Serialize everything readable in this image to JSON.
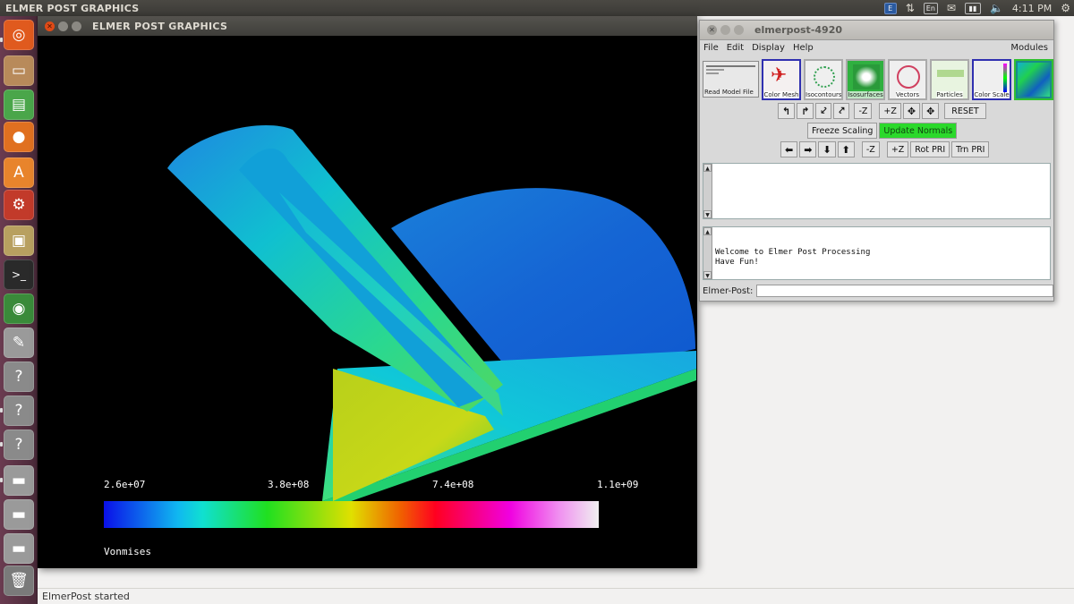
{
  "top_panel": {
    "title": "ELMER POST GRAPHICS",
    "tray": {
      "e_icon": "E",
      "keyboard": "En",
      "clock": "4:11 PM"
    }
  },
  "launcher": {
    "icons": [
      {
        "name": "ubuntu-dash-icon",
        "glyph": "◎",
        "color": "#e05a1e"
      },
      {
        "name": "files-icon",
        "glyph": "▭",
        "color": "#b88a5a"
      },
      {
        "name": "spreadsheet-icon",
        "glyph": "▤",
        "color": "#4aa64a"
      },
      {
        "name": "firefox-icon",
        "glyph": "●",
        "color": "#e07020"
      },
      {
        "name": "software-center-icon",
        "glyph": "A",
        "color": "#e8842c"
      },
      {
        "name": "settings-icon",
        "glyph": "⚙",
        "color": "#c23a2a"
      },
      {
        "name": "archive-icon",
        "glyph": "▣",
        "color": "#b8a060"
      },
      {
        "name": "terminal-icon",
        "glyph": ">_",
        "color": "#2a2a2a"
      },
      {
        "name": "chrome-icon",
        "glyph": "◉",
        "color": "#3a8a3a"
      },
      {
        "name": "text-editor-icon",
        "glyph": "✎",
        "color": "#9a9a9a"
      },
      {
        "name": "unknown-app-icon",
        "glyph": "?",
        "color": "#8a8a8a"
      },
      {
        "name": "unknown-app-icon",
        "glyph": "?",
        "color": "#8a8a8a"
      },
      {
        "name": "unknown-app-icon",
        "glyph": "?",
        "color": "#8a8a8a"
      },
      {
        "name": "drive-icon",
        "glyph": "▬",
        "color": "#9a9a9a"
      },
      {
        "name": "drive-icon",
        "glyph": "▬",
        "color": "#9a9a9a"
      },
      {
        "name": "drive-icon",
        "glyph": "▬",
        "color": "#9a9a9a"
      },
      {
        "name": "trash-icon",
        "glyph": "🗑",
        "color": "#7a7a7a"
      }
    ]
  },
  "graphics_window": {
    "title": "ELMER POST GRAPHICS",
    "legend": {
      "ticks": [
        "2.6e+07",
        "3.8e+08",
        "7.4e+08",
        "1.1e+09"
      ],
      "variable": "Vonmises"
    }
  },
  "status_bar": {
    "text": "ElmerPost started"
  },
  "control_window": {
    "title": "elmerpost-4920",
    "menu": [
      "File",
      "Edit",
      "Display",
      "Help"
    ],
    "menu_right": "Modules",
    "read_model_file": "Read Model File",
    "modules": [
      {
        "label": "Color Mesh",
        "active": true
      },
      {
        "label": "Isocontours",
        "active": false
      },
      {
        "label": "Isosurfaces",
        "active": false
      },
      {
        "label": "Vectors",
        "active": false
      },
      {
        "label": "Particles",
        "active": false
      },
      {
        "label": "Color Scale",
        "active": true
      },
      {
        "label": "",
        "active": false
      }
    ],
    "rotate_row": {
      "minus_z": "-Z",
      "plus_z": "+Z",
      "reset": "RESET"
    },
    "freeze_scaling": "Freeze Scaling",
    "update_normals": "Update Normals",
    "translate_row": {
      "minus_z": "-Z",
      "plus_z": "+Z",
      "rot_pri": "Rot PRI",
      "trn_pri": "Trn PRI"
    },
    "output_text": "Welcome to Elmer Post Processing\nHave Fun!",
    "command_label": "Elmer-Post:",
    "command_value": ""
  }
}
